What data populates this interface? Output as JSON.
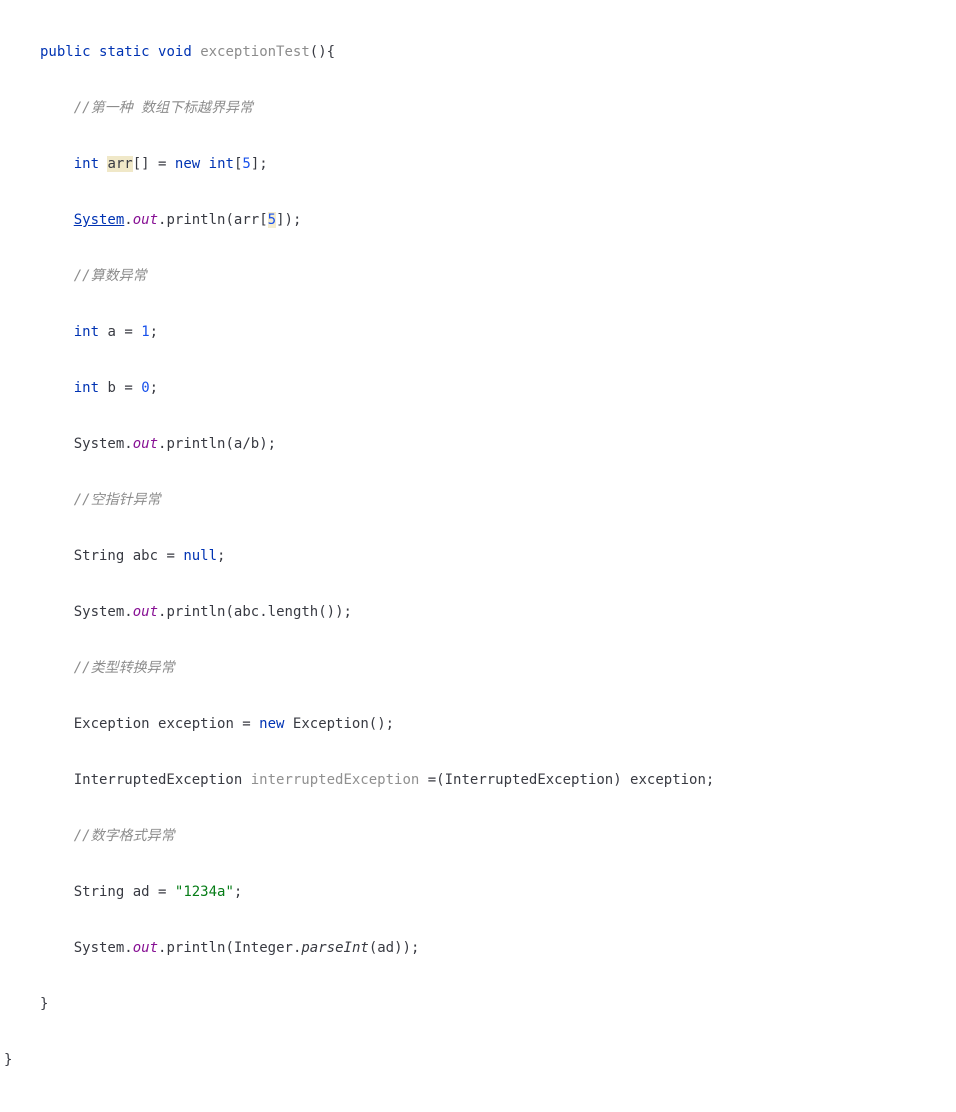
{
  "code": {
    "l1": {
      "kw_public": "public",
      "kw_static": "static",
      "kw_void": "void",
      "method": "exceptionTest",
      "paren_open": "(",
      "paren_close": ")",
      "brace": "{"
    },
    "l2": {
      "comment": "//第一种 数组下标越界异常"
    },
    "l3": {
      "kw_int": "int",
      "var": "arr",
      "brackets": "[]",
      "eq": " = ",
      "kw_new": "new",
      "kw_int2": "int",
      "ob": "[",
      "num": "5",
      "cb": "]",
      "semi": ";"
    },
    "l4": {
      "system": "System",
      "dot1": ".",
      "out": "out",
      "dot2": ".",
      "println": "println",
      "op": "(",
      "arr": "arr",
      "ob": "[",
      "idx": "5",
      "cb": "]",
      "cp": ")",
      "semi": ";"
    },
    "l5": {
      "comment": "//算数异常"
    },
    "l6": {
      "kw_int": "int",
      "var": "a",
      "eq": " = ",
      "num": "1",
      "semi": ";"
    },
    "l7": {
      "kw_int": "int",
      "var": "b",
      "eq": " = ",
      "num": "0",
      "semi": ";"
    },
    "l8": {
      "system": "System",
      "dot1": ".",
      "out": "out",
      "dot2": ".",
      "println": "println",
      "op": "(",
      "a": "a",
      "slash": "/",
      "b": "b",
      "cp": ")",
      "semi": ";"
    },
    "l9": {
      "comment": "//空指针异常"
    },
    "l10": {
      "cls": "String",
      "var": "abc",
      "eq": " = ",
      "kw_null": "null",
      "semi": ";"
    },
    "l11": {
      "system": "System",
      "dot1": ".",
      "out": "out",
      "dot2": ".",
      "println": "println",
      "op": "(",
      "abc": "abc",
      "dot3": ".",
      "length": "length",
      "pp": "()",
      "cp": ")",
      "semi": ";"
    },
    "l12": {
      "comment": "//类型转换异常"
    },
    "l13": {
      "cls": "Exception",
      "var": "exception",
      "eq": " = ",
      "kw_new": "new",
      "cls2": "Exception",
      "pp": "()",
      "semi": ";"
    },
    "l14": {
      "cls": "InterruptedException",
      "var": "interruptedException",
      "eq": " =",
      "op": "(",
      "cast": "InterruptedException",
      "cp": ")",
      "ref": " exception",
      "semi": ";"
    },
    "l15": {
      "comment": "//数字格式异常"
    },
    "l16": {
      "cls": "String",
      "var": "ad",
      "eq": " = ",
      "str": "\"1234a\"",
      "semi": ";"
    },
    "l17": {
      "system": "System",
      "dot1": ".",
      "out": "out",
      "dot2": ".",
      "println": "println",
      "op": "(",
      "integer": "Integer",
      "dot3": ".",
      "parseInt": "parseInt",
      "op2": "(",
      "ad": "ad",
      "cp2": ")",
      "cp": ")",
      "semi": ";"
    },
    "l18": {
      "brace": "}"
    },
    "l19": {
      "brace": "}"
    }
  }
}
